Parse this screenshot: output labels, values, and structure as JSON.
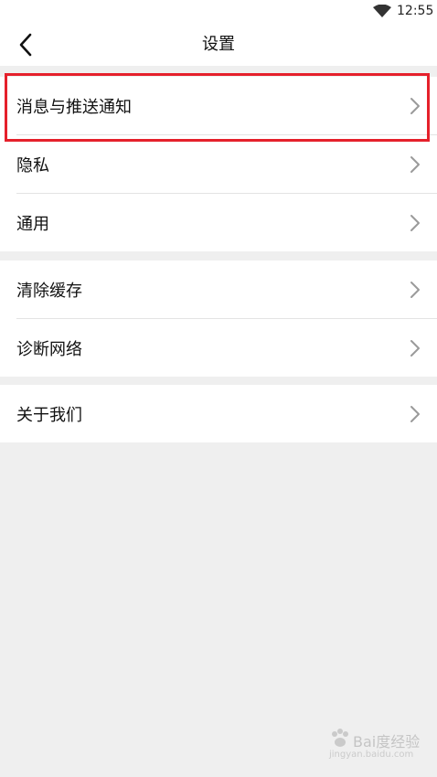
{
  "status_bar": {
    "time": "12:55",
    "wifi_icon": "wifi-icon"
  },
  "header": {
    "title": "设置",
    "back_icon": "back-arrow-icon"
  },
  "groups": [
    {
      "items": [
        {
          "label": "消息与推送通知",
          "highlighted": true
        },
        {
          "label": "隐私"
        },
        {
          "label": "通用"
        }
      ]
    },
    {
      "items": [
        {
          "label": "清除缓存"
        },
        {
          "label": "诊断网络"
        }
      ]
    },
    {
      "items": [
        {
          "label": "关于我们"
        }
      ]
    }
  ],
  "watermark": {
    "text": "Bai度经验",
    "sub": "jingyan.baidu.com"
  },
  "colors": {
    "highlight": "#e5202b",
    "background": "#efefef",
    "chevron": "#9a9a9a"
  }
}
